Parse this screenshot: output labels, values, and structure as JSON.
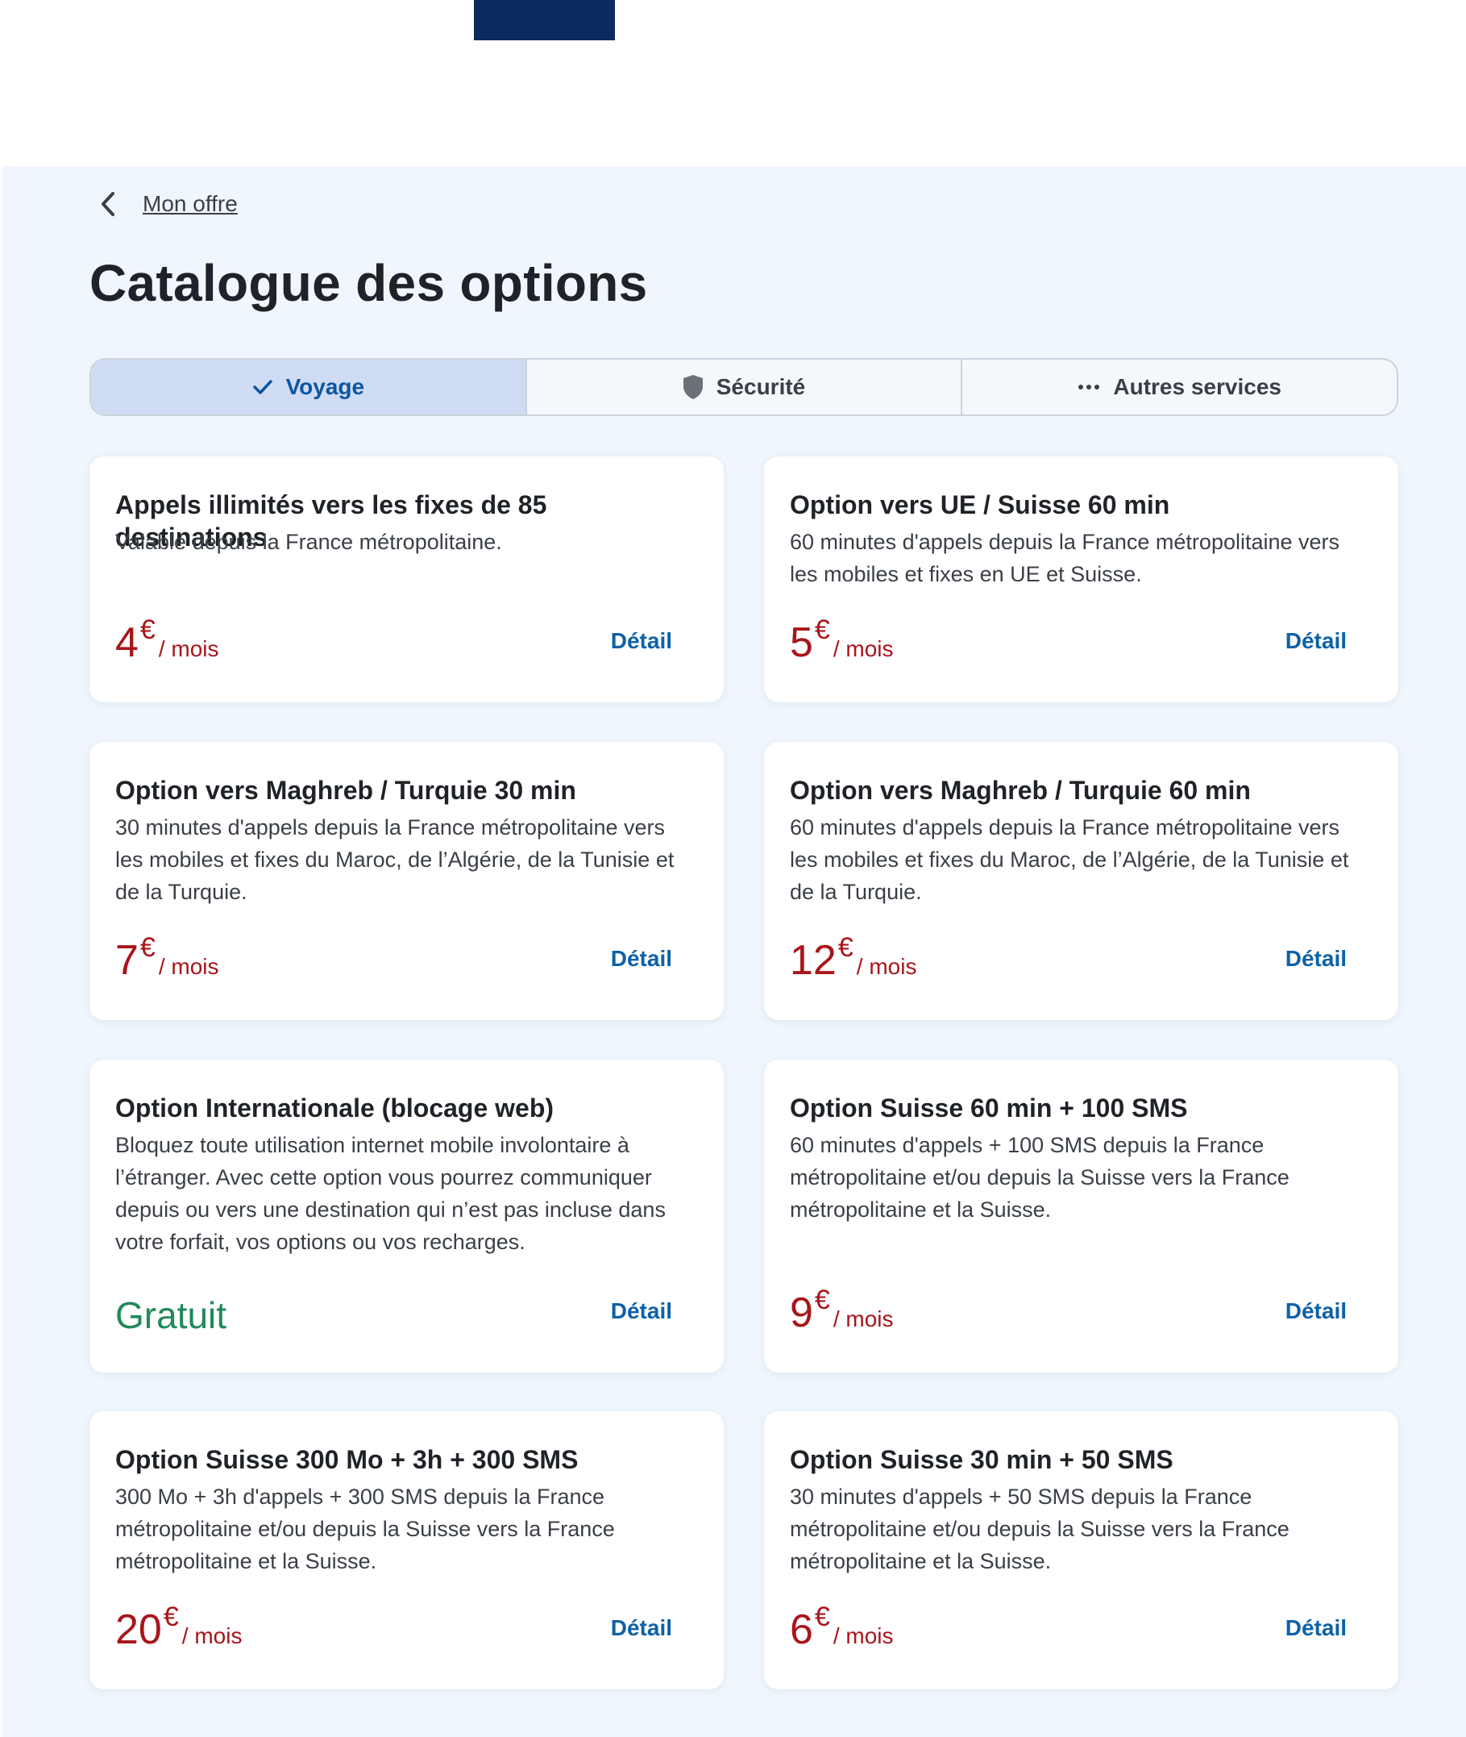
{
  "breadcrumb": {
    "label": "Mon offre"
  },
  "page": {
    "title": "Catalogue des options"
  },
  "tabs": [
    {
      "label": "Voyage",
      "icon": "check-icon",
      "active": true
    },
    {
      "label": "Sécurité",
      "icon": "shield-icon",
      "active": false
    },
    {
      "label": "Autres services",
      "icon": "more-dots-icon",
      "active": false
    }
  ],
  "colors": {
    "brand": "#0b2a5e",
    "price": "#a8151b",
    "free": "#218a5a",
    "link": "#0d61a8",
    "active_tab": "#cfdcf3"
  },
  "cards": [
    {
      "title": "Appels illimités vers les fixes de 85 destinations",
      "desc": "Valable depuis la France métropolitaine.",
      "price": "4",
      "currency": "€",
      "period": "/ mois",
      "detail": "Détail"
    },
    {
      "title": "Option vers UE / Suisse 60 min",
      "desc": "60 minutes d'appels depuis la France métropolitaine vers les mobiles et fixes en UE et Suisse.",
      "price": "5",
      "currency": "€",
      "period": "/ mois",
      "detail": "Détail"
    },
    {
      "title": "Option vers Maghreb / Turquie 30 min",
      "desc": "30 minutes d'appels depuis la France métropolitaine vers les mobiles et fixes du Maroc, de l’Algérie, de la Tunisie et de la Turquie.",
      "price": "7",
      "currency": "€",
      "period": "/ mois",
      "detail": "Détail"
    },
    {
      "title": "Option vers Maghreb / Turquie 60 min",
      "desc": "60 minutes d'appels depuis la France métropolitaine vers les mobiles et fixes du Maroc, de l’Algérie, de la Tunisie et de la Turquie.",
      "price": "12",
      "currency": "€",
      "period": "/ mois",
      "detail": "Détail"
    },
    {
      "title": "Option Internationale (blocage web)",
      "desc": "Bloquez toute utilisation internet mobile involontaire à l’étranger. Avec cette option vous pourrez communiquer depuis ou vers une destination qui n’est pas incluse dans votre forfait, vos options ou vos recharges.",
      "free": "Gratuit",
      "detail": "Détail"
    },
    {
      "title": "Option Suisse 60 min + 100 SMS",
      "desc": "60 minutes d'appels + 100 SMS depuis la France métropolitaine et/ou depuis la Suisse vers la France métropolitaine et la Suisse.",
      "price": "9",
      "currency": "€",
      "period": "/ mois",
      "detail": "Détail"
    },
    {
      "title": "Option Suisse 300 Mo + 3h + 300 SMS",
      "desc": "300 Mo + 3h d'appels + 300 SMS depuis la France métropolitaine et/ou depuis la Suisse vers la France métropolitaine et la Suisse.",
      "price": "20",
      "currency": "€",
      "period": "/ mois",
      "detail": "Détail"
    },
    {
      "title": "Option Suisse 30 min + 50 SMS",
      "desc": "30 minutes d'appels + 50 SMS depuis la France métropolitaine et/ou depuis la Suisse vers la France métropolitaine et la Suisse.",
      "price": "6",
      "currency": "€",
      "period": "/ mois",
      "detail": "Détail"
    }
  ]
}
